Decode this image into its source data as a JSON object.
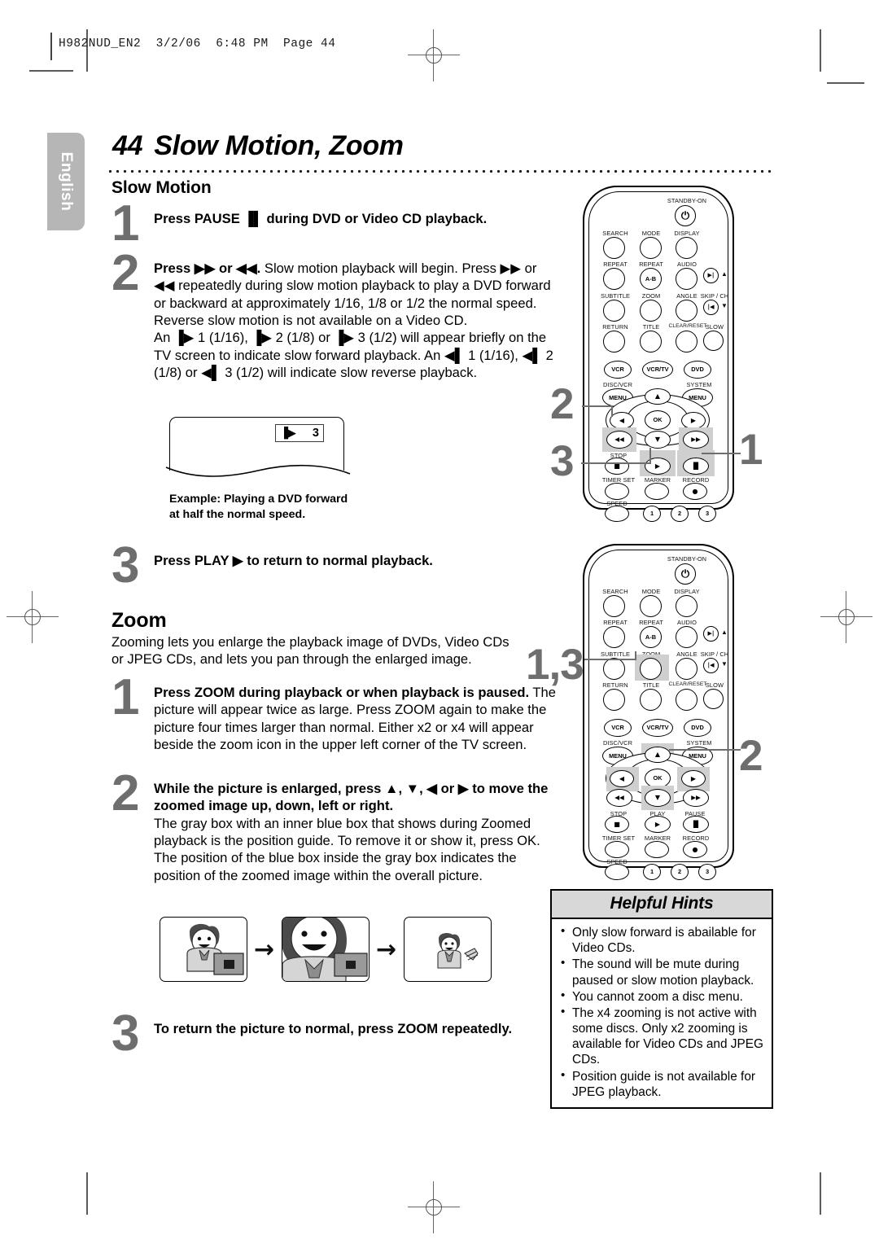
{
  "slug": "H982NUD_EN2  3/2/06  6:48 PM  Page 44",
  "language_tab": "English",
  "page": {
    "number": "44",
    "title": "Slow Motion, Zoom"
  },
  "sections": {
    "slow_motion": {
      "heading": "Slow Motion",
      "steps": [
        {
          "number": "1",
          "lines": [
            {
              "bold": "Press PAUSE ▐▌ during DVD or Video CD playback."
            }
          ]
        },
        {
          "number": "2",
          "text_bold": "Press ▶▶ or ◀◀.",
          "text": " Slow motion playback will begin. Press ▶▶ or ◀◀ repeatedly during slow motion playback to play a DVD forward or backward at approximately 1/16, 1/8 or 1/2 the normal speed. Reverse slow motion is not available on a Video CD.",
          "text2": "An ▐▶ 1 (1/16), ▐▶ 2 (1/8) or ▐▶ 3 (1/2) will appear briefly on the TV screen to indicate slow forward playback. An ◀▌ 1 (1/16), ◀▌ 2 (1/8) or ◀▌ 3 (1/2) will indicate slow reverse playback."
        },
        {
          "number": "3",
          "lines": [
            {
              "bold": "Press PLAY ▶ to return to normal playback."
            }
          ]
        }
      ],
      "figure": {
        "osd_icon": "▐▶",
        "osd_value": "3",
        "caption_line1": "Example: Playing a DVD forward",
        "caption_line2": "at half the normal speed."
      }
    },
    "zoom": {
      "heading": "Zoom",
      "intro": "Zooming lets you enlarge the playback image of DVDs, Video CDs or JPEG CDs, and lets you pan through the enlarged image.",
      "steps": [
        {
          "number": "1",
          "text_bold": "Press ZOOM during playback or when playback is paused.",
          "text": " The picture will appear twice as large. Press ZOOM again to make the picture four times larger than normal. Either x2 or x4 will appear beside the zoom icon in the upper left corner of the TV screen."
        },
        {
          "number": "2",
          "text_bold": "While the picture is enlarged, press ▲, ▼, ◀ or ▶ to move the zoomed image up, down, left or right.",
          "text": "The gray box with an inner blue box that shows during Zoomed playback is the position guide. To remove it or show it, press OK. The position of the blue box inside the gray box indicates the position of the zoomed image within the overall picture."
        },
        {
          "number": "3",
          "text_bold": "To return the picture to normal, press ZOOM repeatedly."
        }
      ],
      "strip_arrow": "→"
    }
  },
  "helpful_hints": {
    "title": "Helpful Hints",
    "items": [
      "Only slow forward is abailable for Video CDs.",
      "The sound will be mute during paused or slow motion playback.",
      "You cannot zoom a disc menu.",
      "The x4 zooming is not active with some discs. Only x2 zooming is available for Video CDs and JPEG CDs.",
      "Position guide is not available for JPEG playback."
    ]
  },
  "remote": {
    "standby_label": "STANDBY-ON",
    "power_glyph": "⏻",
    "rows": [
      [
        "SEARCH",
        "MODE",
        "DISPLAY"
      ],
      [
        "REPEAT",
        "REPEAT",
        "AUDIO"
      ],
      [
        "SUBTITLE",
        "ZOOM",
        "ANGLE"
      ],
      [
        "RETURN",
        "TITLE",
        "CLEAR/RESET"
      ]
    ],
    "ab_label": "A-B",
    "skip_label": "SKIP / CH",
    "slow_label": "SLOW",
    "skip_fwd_glyph": "▶|",
    "skip_rev_glyph": "|◀",
    "up_caret": "▲",
    "down_caret": "▼",
    "source_buttons": [
      "VCR",
      "VCR/TV",
      "DVD"
    ],
    "menu_labels": {
      "left": "DISC/VCR",
      "right": "SYSTEM",
      "button": "MENU"
    },
    "ok_label": "OK",
    "nav": {
      "up": "▲",
      "down": "▼",
      "left": "◀",
      "right": "▶"
    },
    "rew_glyph": "◀◀",
    "ff_glyph": "▶▶",
    "transport_labels": [
      "STOP",
      "PLAY",
      "PAUSE"
    ],
    "transport_glyphs": [
      "■",
      "▶",
      "▐▌"
    ],
    "bottom_labels": [
      "TIMER SET",
      "MARKER",
      "RECORD"
    ],
    "record_glyph": "●",
    "speed_label": "SPEED",
    "number_buttons": [
      "1",
      "2",
      "3"
    ]
  },
  "callouts": {
    "remote1": {
      "a": "2",
      "b": "3",
      "c": "1"
    },
    "remote2": {
      "a": "1,3",
      "b": "2"
    }
  },
  "colors": {
    "callout_gray": "#6e6e6e",
    "highlight_gray": "#cfcfcf",
    "tab_gray": "#b6b6b6",
    "hints_header": "#d8d8d8"
  }
}
